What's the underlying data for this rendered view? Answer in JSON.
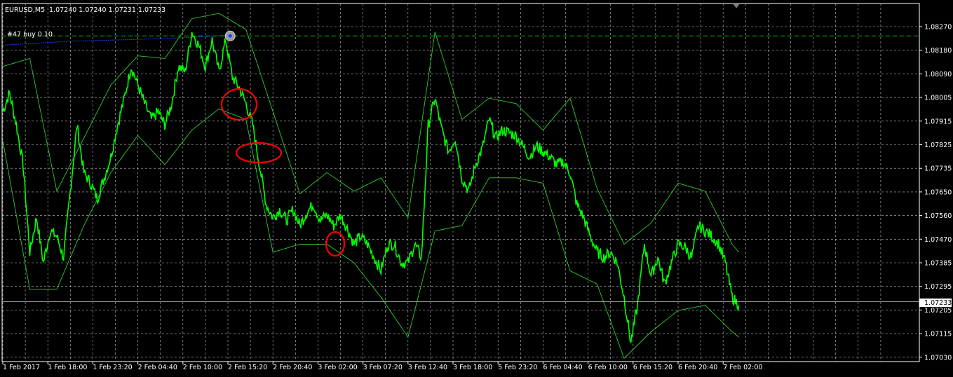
{
  "window": {
    "symbol": "EURUSD,M5",
    "ohlc": "1.07240 1.07240 1.07231 1.07233"
  },
  "order_label": "#47 buy 0.10",
  "current_price_label": "1.07233",
  "colors": {
    "background": "#000000",
    "grid": "#c0c0c0",
    "price_line": "#00ff00",
    "bands": "#2ecc2e",
    "ma": "#1f3aff",
    "markup": "#ff0000",
    "order_line": "#00c000",
    "frame": "#ffffff"
  },
  "chart_data": {
    "type": "line",
    "instrument": "EURUSD",
    "timeframe": "M5",
    "y_ticks": [
      "1.08270",
      "1.08180",
      "1.08090",
      "1.08005",
      "1.07915",
      "1.07825",
      "1.07735",
      "1.07650",
      "1.07560",
      "1.07470",
      "1.07385",
      "1.07295",
      "1.07205",
      "1.07115",
      "1.07030"
    ],
    "x_ticks": [
      "1 Feb 2017",
      "1 Feb 18:00",
      "1 Feb 23:20",
      "2 Feb 04:40",
      "2 Feb 10:00",
      "2 Feb 15:20",
      "2 Feb 20:40",
      "3 Feb 02:00",
      "3 Feb 07:20",
      "3 Feb 12:40",
      "3 Feb 18:00",
      "5 Feb 23:20",
      "6 Feb 04:40",
      "6 Feb 10:00",
      "6 Feb 15:20",
      "6 Feb 20:40",
      "7 Feb 02:00"
    ],
    "ylim": [
      1.0701,
      1.0831
    ],
    "order_level": 1.08235,
    "current_price": 1.07233,
    "price": [
      [
        0,
        1.0795
      ],
      [
        0.3,
        1.0802
      ],
      [
        0.6,
        1.079
      ],
      [
        0.9,
        1.0775
      ],
      [
        1.2,
        1.0742
      ],
      [
        1.5,
        1.0755
      ],
      [
        1.8,
        1.0738
      ],
      [
        2.1,
        1.075
      ],
      [
        2.4,
        1.0748
      ],
      [
        2.7,
        1.074
      ],
      [
        3.0,
        1.0765
      ],
      [
        3.3,
        1.079
      ],
      [
        3.6,
        1.0772
      ],
      [
        3.9,
        1.0768
      ],
      [
        4.2,
        1.0762
      ],
      [
        4.5,
        1.077
      ],
      [
        4.8,
        1.0778
      ],
      [
        5.1,
        1.079
      ],
      [
        5.4,
        1.08
      ],
      [
        5.7,
        1.0812
      ],
      [
        6.0,
        1.0805
      ],
      [
        6.3,
        1.0798
      ],
      [
        6.6,
        1.0792
      ],
      [
        6.9,
        1.0795
      ],
      [
        7.2,
        1.079
      ],
      [
        7.5,
        1.0798
      ],
      [
        7.8,
        1.0812
      ],
      [
        8.1,
        1.081
      ],
      [
        8.4,
        1.0825
      ],
      [
        8.7,
        1.082
      ],
      [
        9.0,
        1.0812
      ],
      [
        9.3,
        1.0822
      ],
      [
        9.6,
        1.081
      ],
      [
        9.9,
        1.0822
      ],
      [
        10.2,
        1.0808
      ],
      [
        10.5,
        1.0804
      ],
      [
        10.8,
        1.0798
      ],
      [
        11.1,
        1.079
      ],
      [
        11.4,
        1.0775
      ],
      [
        11.7,
        1.076
      ],
      [
        12.0,
        1.0755
      ],
      [
        12.3,
        1.0758
      ],
      [
        12.6,
        1.0754
      ],
      [
        12.9,
        1.0758
      ],
      [
        13.2,
        1.0752
      ],
      [
        13.5,
        1.0757
      ],
      [
        13.8,
        1.076
      ],
      [
        14.1,
        1.0754
      ],
      [
        14.4,
        1.0756
      ],
      [
        14.7,
        1.0752
      ],
      [
        15.0,
        1.0756
      ],
      [
        15.3,
        1.0751
      ],
      [
        15.6,
        1.0745
      ],
      [
        15.9,
        1.0748
      ],
      [
        16.2,
        1.0745
      ],
      [
        16.5,
        1.074
      ],
      [
        16.8,
        1.0735
      ],
      [
        17.1,
        1.0745
      ],
      [
        17.4,
        1.0745
      ],
      [
        17.7,
        1.0738
      ],
      [
        18.0,
        1.0738
      ],
      [
        18.3,
        1.0745
      ],
      [
        18.6,
        1.074
      ],
      [
        18.9,
        1.079
      ],
      [
        19.2,
        1.08
      ],
      [
        19.5,
        1.0788
      ],
      [
        19.8,
        1.078
      ],
      [
        20.1,
        1.0785
      ],
      [
        20.4,
        1.077
      ],
      [
        20.7,
        1.0765
      ],
      [
        21.0,
        1.0775
      ],
      [
        21.3,
        1.0781
      ],
      [
        21.6,
        1.0792
      ],
      [
        21.9,
        1.0785
      ],
      [
        22.2,
        1.0788
      ],
      [
        22.5,
        1.0787
      ],
      [
        22.8,
        1.0786
      ],
      [
        23.1,
        1.0782
      ],
      [
        23.4,
        1.0778
      ],
      [
        23.7,
        1.0782
      ],
      [
        24.0,
        1.078
      ],
      [
        24.3,
        1.0778
      ],
      [
        24.6,
        1.0775
      ],
      [
        24.9,
        1.0776
      ],
      [
        25.2,
        1.0772
      ],
      [
        25.5,
        1.076
      ],
      [
        25.8,
        1.0755
      ],
      [
        26.1,
        1.0748
      ],
      [
        26.4,
        1.0742
      ],
      [
        26.7,
        1.074
      ],
      [
        27.0,
        1.0742
      ],
      [
        27.3,
        1.0738
      ],
      [
        27.6,
        1.0725
      ],
      [
        27.9,
        1.0708
      ],
      [
        28.2,
        1.0722
      ],
      [
        28.5,
        1.0745
      ],
      [
        28.8,
        1.0733
      ],
      [
        29.1,
        1.074
      ],
      [
        29.4,
        1.073
      ],
      [
        29.7,
        1.0738
      ],
      [
        30.0,
        1.0745
      ],
      [
        30.3,
        1.0744
      ],
      [
        30.6,
        1.074
      ],
      [
        30.9,
        1.0752
      ],
      [
        31.2,
        1.075
      ],
      [
        31.5,
        1.0748
      ],
      [
        31.8,
        1.0745
      ],
      [
        32.1,
        1.0738
      ],
      [
        32.4,
        1.0725
      ],
      [
        32.7,
        1.0722
      ]
    ],
    "upper_band": [
      [
        0,
        1.0812
      ],
      [
        1.2,
        1.0815
      ],
      [
        2.4,
        1.0765
      ],
      [
        3.6,
        1.0785
      ],
      [
        4.8,
        1.0805
      ],
      [
        6.0,
        1.0816
      ],
      [
        7.2,
        1.0815
      ],
      [
        8.4,
        1.083
      ],
      [
        9.6,
        1.0832
      ],
      [
        10.8,
        1.0826
      ],
      [
        12.0,
        1.0795
      ],
      [
        13.2,
        1.0764
      ],
      [
        14.4,
        1.0772
      ],
      [
        15.6,
        1.0765
      ],
      [
        16.8,
        1.077
      ],
      [
        18.0,
        1.0755
      ],
      [
        19.2,
        1.0825
      ],
      [
        20.4,
        1.0792
      ],
      [
        21.6,
        1.08
      ],
      [
        22.8,
        1.0798
      ],
      [
        24.0,
        1.0788
      ],
      [
        25.2,
        1.08
      ],
      [
        26.4,
        1.0766
      ],
      [
        27.6,
        1.0745
      ],
      [
        28.8,
        1.0753
      ],
      [
        30.0,
        1.0768
      ],
      [
        31.2,
        1.0765
      ],
      [
        32.4,
        1.0745
      ],
      [
        32.7,
        1.0742
      ]
    ],
    "lower_band": [
      [
        0,
        1.0784
      ],
      [
        1.2,
        1.0728
      ],
      [
        2.4,
        1.0728
      ],
      [
        3.6,
        1.0752
      ],
      [
        4.8,
        1.0772
      ],
      [
        6.0,
        1.0786
      ],
      [
        7.2,
        1.0775
      ],
      [
        8.4,
        1.0788
      ],
      [
        9.6,
        1.0796
      ],
      [
        10.8,
        1.0792
      ],
      [
        12.0,
        1.0742
      ],
      [
        13.2,
        1.0745
      ],
      [
        14.4,
        1.0745
      ],
      [
        15.6,
        1.0738
      ],
      [
        16.8,
        1.0725
      ],
      [
        18.0,
        1.071
      ],
      [
        19.2,
        1.075
      ],
      [
        20.4,
        1.0752
      ],
      [
        21.6,
        1.077
      ],
      [
        22.8,
        1.077
      ],
      [
        24.0,
        1.0768
      ],
      [
        25.2,
        1.0735
      ],
      [
        26.4,
        1.073
      ],
      [
        27.6,
        1.0702
      ],
      [
        28.8,
        1.0712
      ],
      [
        30.0,
        1.072
      ],
      [
        31.2,
        1.0722
      ],
      [
        32.4,
        1.0712
      ],
      [
        32.7,
        1.071
      ]
    ],
    "ma": [
      [
        0,
        1.082
      ],
      [
        3,
        1.08215
      ],
      [
        6,
        1.08222
      ],
      [
        8,
        1.08228
      ],
      [
        10.1,
        1.08238
      ]
    ]
  }
}
